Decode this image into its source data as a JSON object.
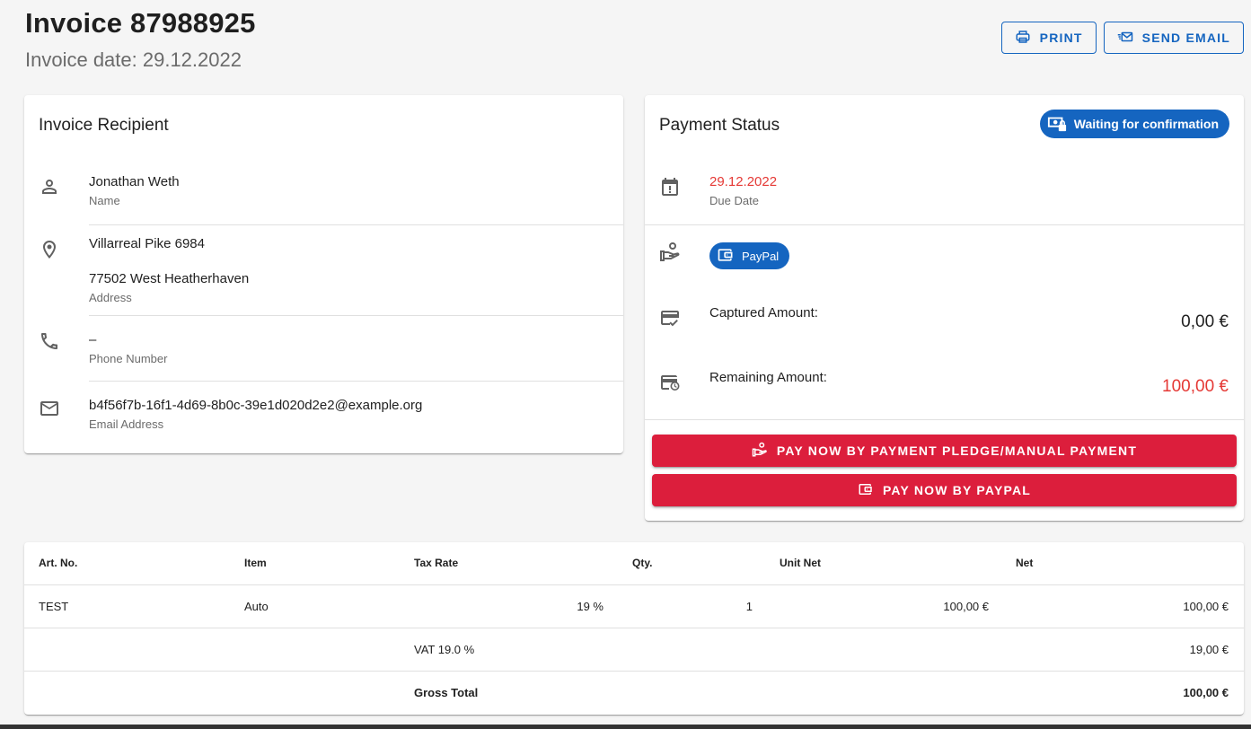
{
  "header": {
    "title": "Invoice 87988925",
    "subtitle": "Invoice date: 29.12.2022",
    "print_label": "PRINT",
    "send_email_label": "SEND EMAIL"
  },
  "recipient": {
    "title": "Invoice Recipient",
    "name": "Jonathan Weth",
    "name_label": "Name",
    "address_line1": "Villarreal Pike 6984",
    "address_line2": "77502 West Heatherhaven",
    "address_label": "Address",
    "phone": "–",
    "phone_label": "Phone Number",
    "email": "b4f56f7b-16f1-4d69-8b0c-39e1d020d2e2@example.org",
    "email_label": "Email Address"
  },
  "payment": {
    "title": "Payment Status",
    "status": "Waiting for confirmation",
    "due_date": "29.12.2022",
    "due_date_label": "Due Date",
    "method": "PayPal",
    "captured_label": "Captured Amount:",
    "captured_amount": "0,00 €",
    "remaining_label": "Remaining Amount:",
    "remaining_amount": "100,00 €",
    "pay_manual_label": "PAY NOW BY PAYMENT PLEDGE/MANUAL PAYMENT",
    "pay_paypal_label": "PAY NOW BY PAYPAL"
  },
  "colors": {
    "primary": "#1565c0",
    "danger": "#dc1e3c",
    "due_date": "#e53935"
  },
  "items_table": {
    "headers": [
      "Art. No.",
      "Item",
      "Tax Rate",
      "Qty.",
      "Unit Net",
      "Net"
    ],
    "row": {
      "art_no": "TEST",
      "item": "Auto",
      "tax_rate": "19 %",
      "qty": "1",
      "unit_net": "100,00 €",
      "net": "100,00 €"
    },
    "vat_label": "VAT 19.0 %",
    "vat_amount": "19,00 €",
    "gross_label": "Gross Total",
    "gross_amount": "100,00 €"
  }
}
